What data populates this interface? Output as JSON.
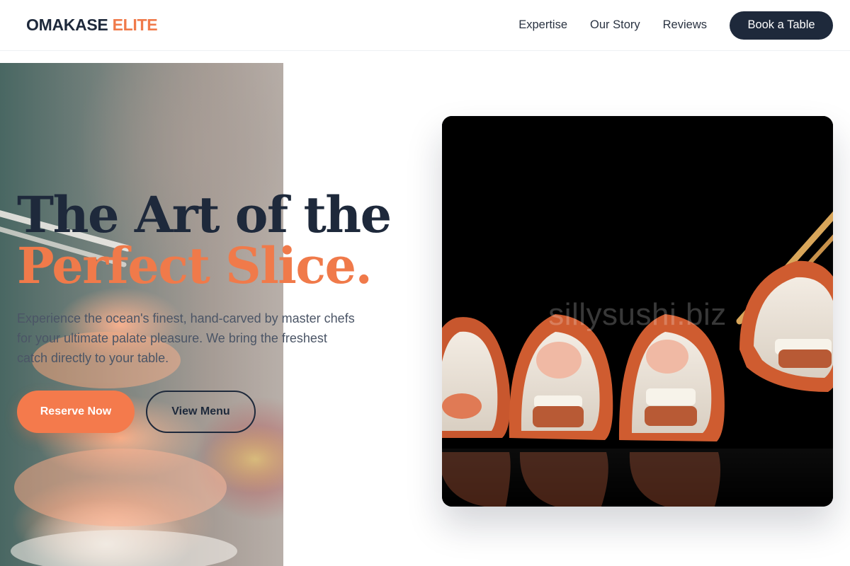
{
  "header": {
    "logo_main": "OMAKASE",
    "logo_accent": "ELITE",
    "nav": [
      "Expertise",
      "Our Story",
      "Reviews"
    ],
    "cta": "Book a Table"
  },
  "hero": {
    "title_line1": "The Art of the",
    "title_line2": "Perfect Slice.",
    "subtitle": "Experience the ocean's finest, hand-carved by master chefs for your ultimate palate pleasure. We bring the freshest catch directly to your table.",
    "primary_button": "Reserve Now",
    "secondary_button": "View Menu"
  },
  "image_card": {
    "watermark": "sillysushi.biz"
  },
  "colors": {
    "navy": "#1e293b",
    "accent": "#f07a4a",
    "background": "#ffffff"
  }
}
